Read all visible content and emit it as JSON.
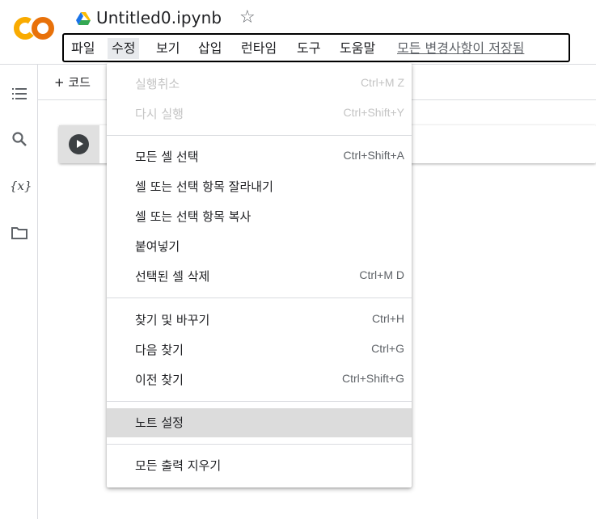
{
  "header": {
    "title": "Untitled0.ipynb",
    "star_icon": "☆",
    "logo": {
      "text": "CO",
      "color": "#f9ab00"
    }
  },
  "menubar": {
    "items": [
      "파일",
      "수정",
      "보기",
      "삽입",
      "런타임",
      "도구",
      "도움말"
    ],
    "active": "수정",
    "save_status": "모든 변경사항이 저장됨"
  },
  "sidebar": {
    "icons": [
      "table-of-contents-icon",
      "search-icon",
      "variables-icon",
      "folder-icon"
    ],
    "variables_glyph": "{x}"
  },
  "toolbar": {
    "add_code": "+ 코드"
  },
  "dropdown": {
    "items": [
      {
        "label": "실행취소",
        "shortcut": "Ctrl+M Z",
        "disabled": true
      },
      {
        "label": "다시 실행",
        "shortcut": "Ctrl+Shift+Y",
        "disabled": true
      },
      {
        "label": "모든 셀 선택",
        "shortcut": "Ctrl+Shift+A",
        "disabled": false
      },
      {
        "label": "셀 또는 선택 항목 잘라내기",
        "shortcut": "",
        "disabled": false
      },
      {
        "label": "셀 또는 선택 항목 복사",
        "shortcut": "",
        "disabled": false
      },
      {
        "label": "붙여넣기",
        "shortcut": "",
        "disabled": false
      },
      {
        "label": "선택된 셀 삭제",
        "shortcut": "Ctrl+M D",
        "disabled": false
      },
      {
        "label": "찾기 및 바꾸기",
        "shortcut": "Ctrl+H",
        "disabled": false
      },
      {
        "label": "다음 찾기",
        "shortcut": "Ctrl+G",
        "disabled": false
      },
      {
        "label": "이전 찾기",
        "shortcut": "Ctrl+Shift+G",
        "disabled": false
      },
      {
        "label": "노트 설정",
        "shortcut": "",
        "disabled": false,
        "highlighted": true
      },
      {
        "label": "모든 출력 지우기",
        "shortcut": "",
        "disabled": false
      }
    ]
  },
  "colors": {
    "accent_orange": "#f9ab00",
    "highlight": "#dcdcdc",
    "disabled_text": "#c4c4c4"
  }
}
